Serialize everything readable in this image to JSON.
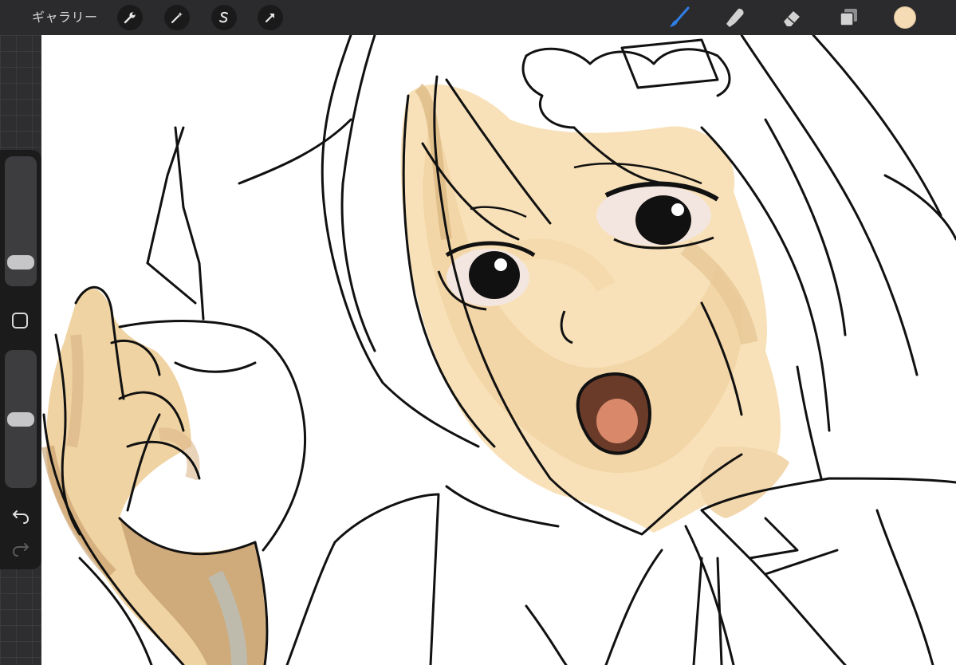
{
  "toolbar": {
    "gallery_label": "ギャラリー",
    "actions_icon": "wrench-icon",
    "adjustments_icon": "magic-wand-icon",
    "selection_icon": "selection-s-icon",
    "transform_icon": "arrow-cursor-icon",
    "brush_icon": "brush-icon",
    "smudge_icon": "smudge-finger-icon",
    "eraser_icon": "eraser-icon",
    "layers_icon": "layers-icon",
    "current_color": "#f6dcb4",
    "active_tool_color": "#2f7fe6"
  },
  "sidebar": {
    "brush_size_level": 0.13,
    "opacity_level": 0.5,
    "modify_icon": "square-icon",
    "undo_icon": "undo-icon",
    "redo_icon": "redo-icon"
  },
  "colors": {
    "toolbar_bg": "#2b2b2d",
    "canvas_bg": "#ffffff",
    "skin": "#f7dfb4",
    "shade": "#e2c089",
    "line": "#111111"
  }
}
